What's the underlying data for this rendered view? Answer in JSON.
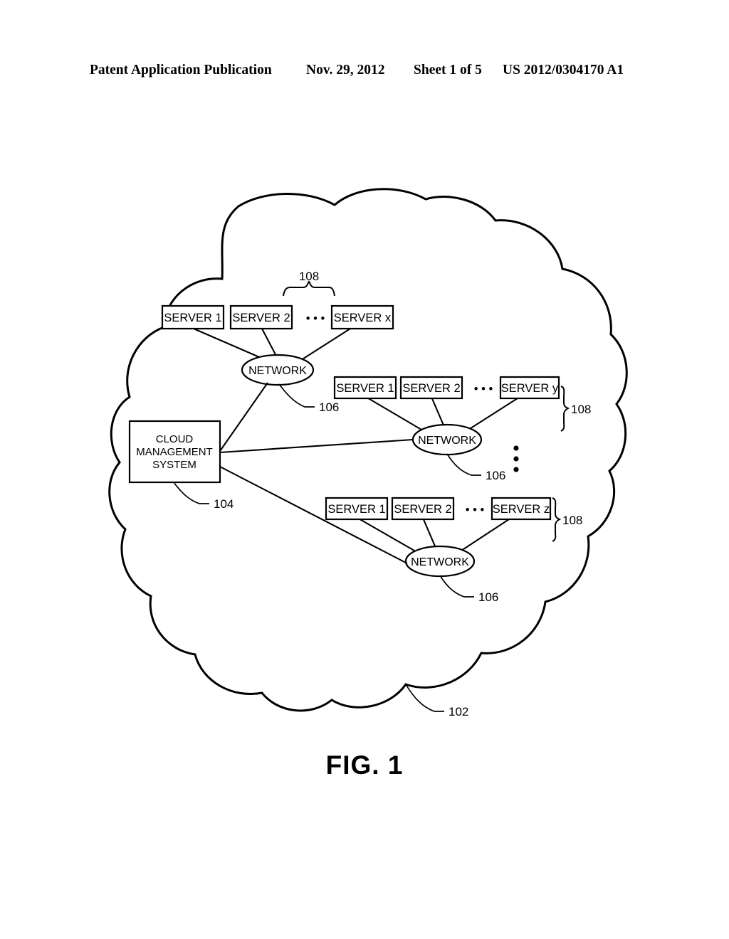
{
  "header": {
    "publication": "Patent Application Publication",
    "date": "Nov. 29, 2012",
    "sheet": "Sheet 1 of 5",
    "number": "US 2012/0304170 A1"
  },
  "figure": {
    "caption": "FIG. 1",
    "cloud_label": "102",
    "cloud_name": "cloud"
  },
  "cms": {
    "line1": "CLOUD",
    "line2": "MANAGEMENT",
    "line3": "SYSTEM",
    "ref": "104"
  },
  "groups": [
    {
      "id": "group-x",
      "network_label": "NETWORK",
      "network_ref": "106",
      "brace_ref": "108",
      "brace_orientation": "top",
      "servers": [
        {
          "label": "SERVER 1"
        },
        {
          "label": "SERVER 2"
        },
        {
          "label": "SERVER x"
        }
      ],
      "ellipsis": "• • •"
    },
    {
      "id": "group-y",
      "network_label": "NETWORK",
      "network_ref": "106",
      "brace_ref": "108",
      "brace_orientation": "right",
      "servers": [
        {
          "label": "SERVER 1"
        },
        {
          "label": "SERVER 2"
        },
        {
          "label": "SERVER y"
        }
      ],
      "ellipsis": "• • •"
    },
    {
      "id": "group-z",
      "network_label": "NETWORK",
      "network_ref": "106",
      "brace_ref": "108",
      "brace_orientation": "right",
      "servers": [
        {
          "label": "SERVER 1"
        },
        {
          "label": "SERVER 2"
        },
        {
          "label": "SERVER z"
        }
      ],
      "ellipsis": "• • •"
    }
  ],
  "vertical_ellipsis": "⋮",
  "colors": {
    "ink": "#000000",
    "paper": "#ffffff"
  }
}
